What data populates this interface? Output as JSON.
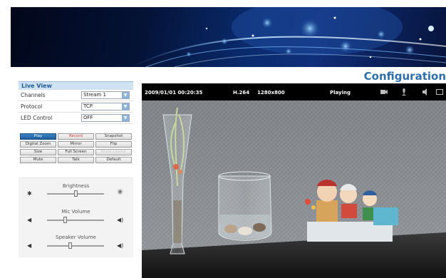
{
  "config_link": "Configuration",
  "live_view": {
    "title": "Live View",
    "settings": [
      {
        "label": "Channels",
        "value": "Stream 1"
      },
      {
        "label": "Protocol",
        "value": "TCP"
      },
      {
        "label": "LED Control",
        "value": "OFF"
      }
    ],
    "buttons": [
      {
        "label": "Play",
        "state": "active"
      },
      {
        "label": "Record",
        "state": "red"
      },
      {
        "label": "Snapshot",
        "state": "normal"
      },
      {
        "label": "Digital Zoom",
        "state": "normal"
      },
      {
        "label": "Mirror",
        "state": "normal"
      },
      {
        "label": "Flip",
        "state": "normal"
      },
      {
        "label": "Size",
        "state": "normal"
      },
      {
        "label": "Full Screen",
        "state": "normal"
      },
      {
        "label": "Show Layout",
        "state": "disabled"
      },
      {
        "label": "Mute",
        "state": "normal"
      },
      {
        "label": "Talk",
        "state": "normal"
      },
      {
        "label": "Default",
        "state": "normal"
      }
    ],
    "sliders": [
      {
        "label": "Brightness",
        "value": 0.5
      },
      {
        "label": "Mic Volume",
        "value": 0.3
      },
      {
        "label": "Speaker Volume",
        "value": 0.4
      }
    ]
  },
  "video": {
    "timestamp": "2009/01/01 00:20:35",
    "codec": "H.264",
    "resolution": "1280x800",
    "status": "Playing"
  }
}
